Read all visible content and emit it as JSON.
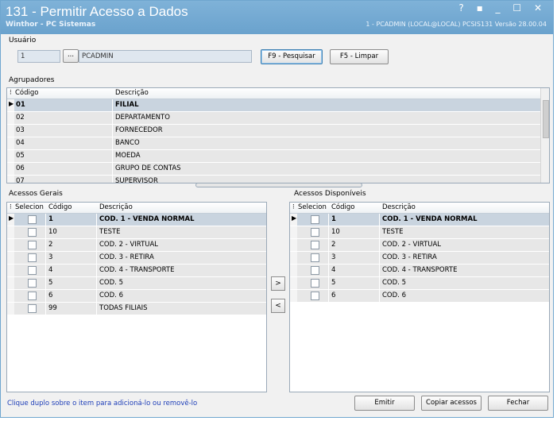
{
  "window": {
    "title": "131 - Permitir Acesso a Dados",
    "subtitle": "Winthor - PC Sistemas",
    "status": "1 - PCADMIN (LOCAL@LOCAL)   PCSIS131  Versão 28.00.04",
    "controls": "? ▪ _ ☐ ✕"
  },
  "usuario": {
    "label": "Usuário",
    "code_value": "1",
    "lookup_label": "...",
    "name_value": "PCADMIN",
    "search_button": "F9 - Pesquisar",
    "clear_button": "F5 - Limpar"
  },
  "agrupadores": {
    "label": "Agrupadores",
    "col_code": "Código",
    "col_desc": "Descrição",
    "rows": [
      {
        "code": "01",
        "desc": "FILIAL"
      },
      {
        "code": "02",
        "desc": "DEPARTAMENTO"
      },
      {
        "code": "03",
        "desc": "FORNECEDOR"
      },
      {
        "code": "04",
        "desc": "BANCO"
      },
      {
        "code": "05",
        "desc": "MOEDA"
      },
      {
        "code": "06",
        "desc": "GRUPO DE CONTAS"
      },
      {
        "code": "07",
        "desc": "SUPERVISOR"
      }
    ]
  },
  "acessos_gerais": {
    "label": "Acessos Gerais",
    "col_sel": "Selecion",
    "col_code": "Código",
    "col_desc": "Descrição",
    "rows": [
      {
        "code": "1",
        "desc": "COD. 1 - VENDA NORMAL"
      },
      {
        "code": "10",
        "desc": "TESTE"
      },
      {
        "code": "2",
        "desc": "COD. 2 - VIRTUAL"
      },
      {
        "code": "3",
        "desc": "COD. 3 - RETIRA"
      },
      {
        "code": "4",
        "desc": "COD. 4 - TRANSPORTE"
      },
      {
        "code": "5",
        "desc": "COD. 5"
      },
      {
        "code": "6",
        "desc": "COD. 6"
      },
      {
        "code": "99",
        "desc": "TODAS FILIAIS"
      }
    ]
  },
  "acessos_disponiveis": {
    "label": "Acessos Disponíveis",
    "col_sel": "Selecion",
    "col_code": "Código",
    "col_desc": "Descrição",
    "rows": [
      {
        "code": "1",
        "desc": "COD. 1 - VENDA NORMAL"
      },
      {
        "code": "10",
        "desc": "TESTE"
      },
      {
        "code": "2",
        "desc": "COD. 2 - VIRTUAL"
      },
      {
        "code": "3",
        "desc": "COD. 3 - RETIRA"
      },
      {
        "code": "4",
        "desc": "COD. 4 - TRANSPORTE"
      },
      {
        "code": "5",
        "desc": "COD. 5"
      },
      {
        "code": "6",
        "desc": "COD. 6"
      }
    ]
  },
  "move": {
    "add": ">",
    "remove": "<"
  },
  "footer": {
    "hint": "Clique duplo sobre o item para adicioná-lo ou removê-lo",
    "emit": "Emitir",
    "copy": "Copiar acessos",
    "close": "Fechar"
  }
}
